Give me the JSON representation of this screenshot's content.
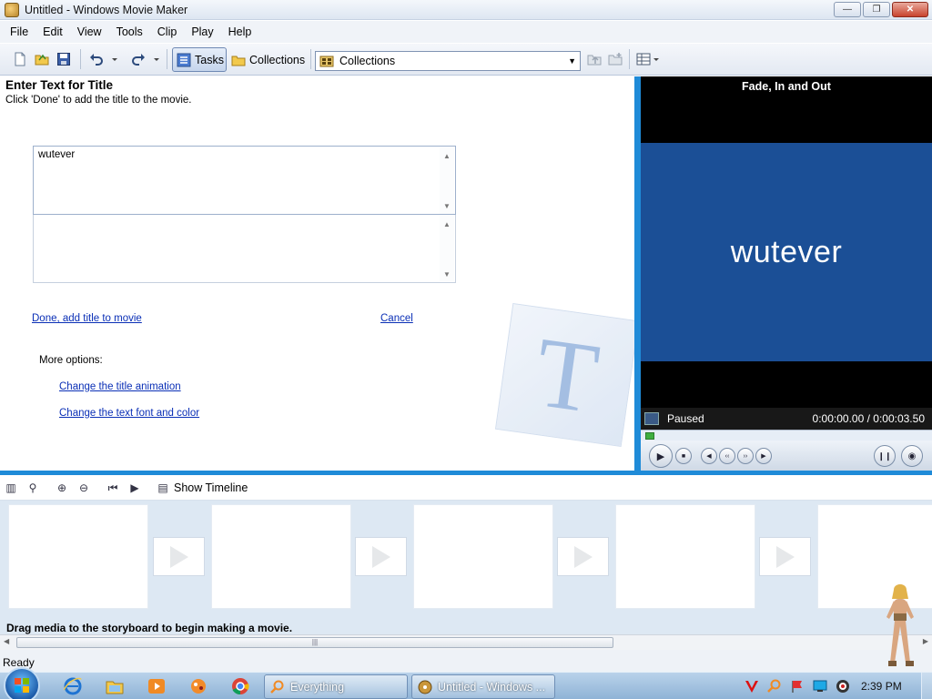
{
  "window": {
    "title": "Untitled - Windows Movie Maker"
  },
  "menu": [
    "File",
    "Edit",
    "View",
    "Tools",
    "Clip",
    "Play",
    "Help"
  ],
  "toolbar": {
    "tasks_label": "Tasks",
    "collections_label": "Collections",
    "collections_select": "Collections"
  },
  "task_pane": {
    "title": "Enter Text for Title",
    "hint": "Click 'Done' to add the title to the movie.",
    "title_text": "wutever",
    "subtitle_text": "",
    "done_link": "Done, add title to movie",
    "cancel_link": "Cancel",
    "more_options": "More options:",
    "animation_link": "Change the title animation",
    "font_link": "Change the text font and color",
    "watermark_letter": "T"
  },
  "monitor": {
    "title": "Fade, In and Out",
    "video_text": "wutever",
    "status": "Paused",
    "time": "0:00:00.00 / 0:00:03.50",
    "progress": 0
  },
  "storyboard": {
    "show_timeline_label": "Show Timeline",
    "hint": "Drag media to the storyboard to begin making a movie.",
    "clip_slots": 5,
    "transition_slots": 4
  },
  "status_bar": {
    "text": "Ready"
  },
  "taskbar": {
    "buttons": [
      "Everything",
      "Untitled - Windows ..."
    ],
    "clock": "2:39 PM"
  },
  "colors": {
    "accent_blue": "#1f8bd8",
    "video_bg": "#1b4f96",
    "link": "#0a2fb6",
    "storyboard_bg": "#dde8f3"
  }
}
